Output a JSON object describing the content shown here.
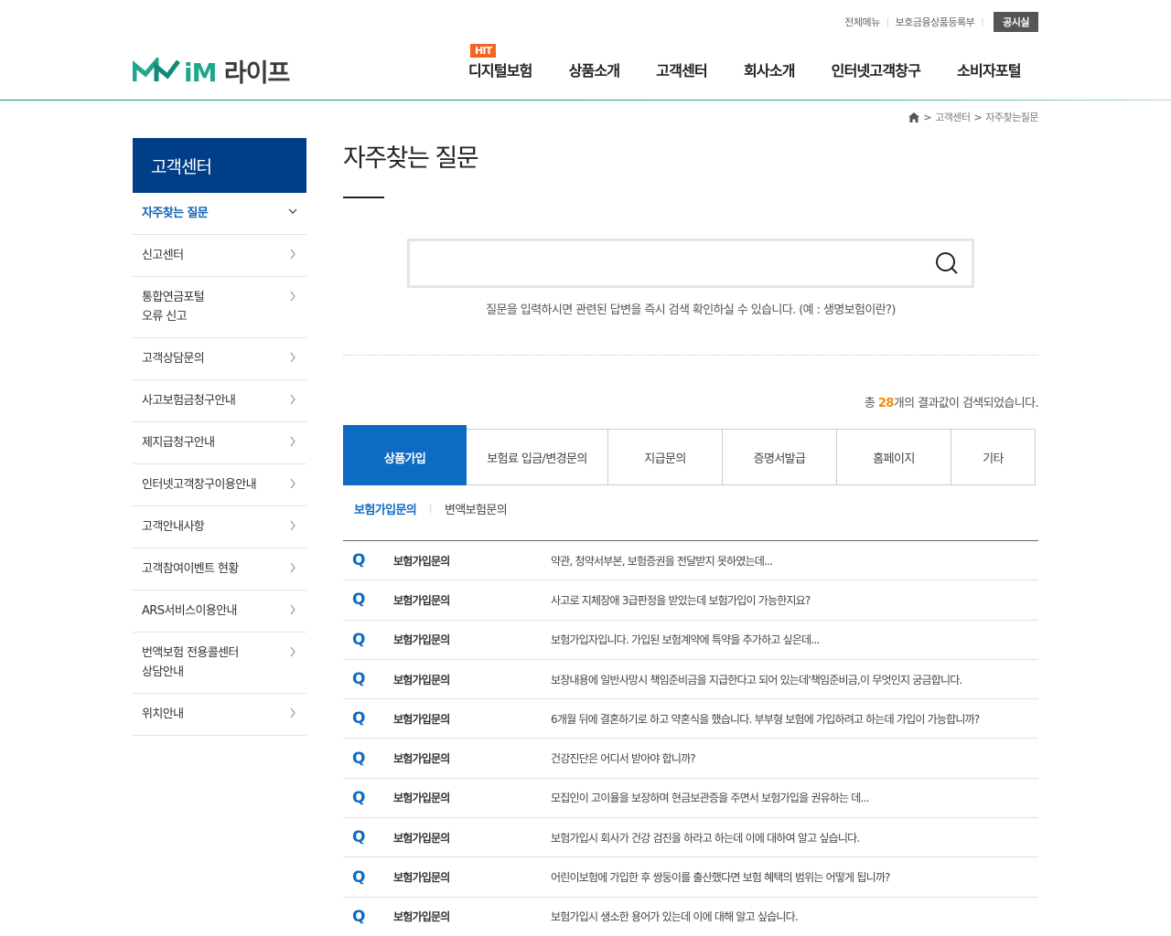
{
  "header": {
    "util": {
      "all_menu": "전체메뉴",
      "product_registry": "보호금융상품등록부",
      "notice": "공시실"
    },
    "logo": {
      "im": "iM",
      "text": "라이프"
    },
    "gnb": [
      {
        "label": "디지털보험",
        "badge": "HIT"
      },
      {
        "label": "상품소개"
      },
      {
        "label": "고객센터"
      },
      {
        "label": "회사소개"
      },
      {
        "label": "인터넷고객창구"
      },
      {
        "label": "소비자포털"
      }
    ]
  },
  "breadcrumb": {
    "level1": "고객센터",
    "level2": "자주찾는질문",
    "gt": ">"
  },
  "lnb": {
    "title": "고객센터",
    "items": [
      {
        "label": "자주찾는 질문",
        "active": true
      },
      {
        "label": "신고센터"
      },
      {
        "label": "통합연금포털\n오류 신고"
      },
      {
        "label": "고객상담문의"
      },
      {
        "label": "사고보험금청구안내"
      },
      {
        "label": "제지급청구안내"
      },
      {
        "label": "인터넷고객창구이용안내"
      },
      {
        "label": "고객안내사항"
      },
      {
        "label": "고객참여이벤트 현황"
      },
      {
        "label": "ARS서비스이용안내"
      },
      {
        "label": "번액보험 전용콜센터\n상담안내"
      },
      {
        "label": "위치안내"
      }
    ]
  },
  "content": {
    "title": "자주찾는 질문",
    "search": {
      "placeholder": "",
      "guide": "질문을 입력하시면 관련된 답변을 즉시 검색 확인하실 수 있습니다. (예 : 생명보험이란?)"
    },
    "result": {
      "prefix": "총 ",
      "count": "28",
      "suffix": "개의 결과값이 검색되었습니다."
    },
    "tabs": [
      {
        "label": "상품가입",
        "active": true
      },
      {
        "label": "보험료 입금/변경문의"
      },
      {
        "label": "지급문의"
      },
      {
        "label": "증명서발급"
      },
      {
        "label": "홈페이지"
      },
      {
        "label": "기타"
      }
    ],
    "subtabs": [
      {
        "label": "보험가입문의",
        "active": true
      },
      {
        "label": "변액보험문의"
      }
    ],
    "faq": [
      {
        "q": "Q",
        "category": "보험가입문의",
        "title": "약관, 청약서부본, 보험증권을 전달받지 못하였는데..."
      },
      {
        "q": "Q",
        "category": "보험가입문의",
        "title": "사고로 지체장애 3급판정을 받았는데 보험가입이 가능한지요?"
      },
      {
        "q": "Q",
        "category": "보험가입문의",
        "title": "보험가입자입니다. 가입된 보험계약에 특약을 추가하고 싶은데..."
      },
      {
        "q": "Q",
        "category": "보험가입문의",
        "title": "보장내용에 일반사망시 책임준비금을 지급한다고 되어 있는데'책임준비금,이 무엇인지 궁금합니다."
      },
      {
        "q": "Q",
        "category": "보험가입문의",
        "title": "6개월 뒤에 결혼하기로 하고 약혼식을 했습니다. 부부형 보험에 가입하려고 하는데 가입이 가능합니까?"
      },
      {
        "q": "Q",
        "category": "보험가입문의",
        "title": "건강진단은 어디서 받아야 합니까?"
      },
      {
        "q": "Q",
        "category": "보험가입문의",
        "title": "모집인이 고이율을 보장하며 현금보관증을 주면서 보험가입을 권유하는 데..."
      },
      {
        "q": "Q",
        "category": "보험가입문의",
        "title": "보험가입시 회사가 건강 검진을 하라고 하는데 이에 대하여 알고 싶습니다."
      },
      {
        "q": "Q",
        "category": "보험가입문의",
        "title": "어린이보험에 가입한 후 쌍둥이를 출산했다면 보험 혜택의 범위는 어떻게 됩니까?"
      },
      {
        "q": "Q",
        "category": "보험가입문의",
        "title": "보험가입시 생소한 용어가 있는데 이에 대해 알고 싶습니다."
      }
    ]
  },
  "colors": {
    "brand_green": "#1fa68c",
    "navy": "#003f87",
    "active_blue": "#0d6bc4",
    "hit_orange": "#f26522",
    "count_orange": "#f08c00"
  },
  "icons": {
    "search": "search-icon",
    "home": "home-icon",
    "chevron_right": "chevron-right-icon",
    "chevron_down": "chevron-down-icon"
  }
}
